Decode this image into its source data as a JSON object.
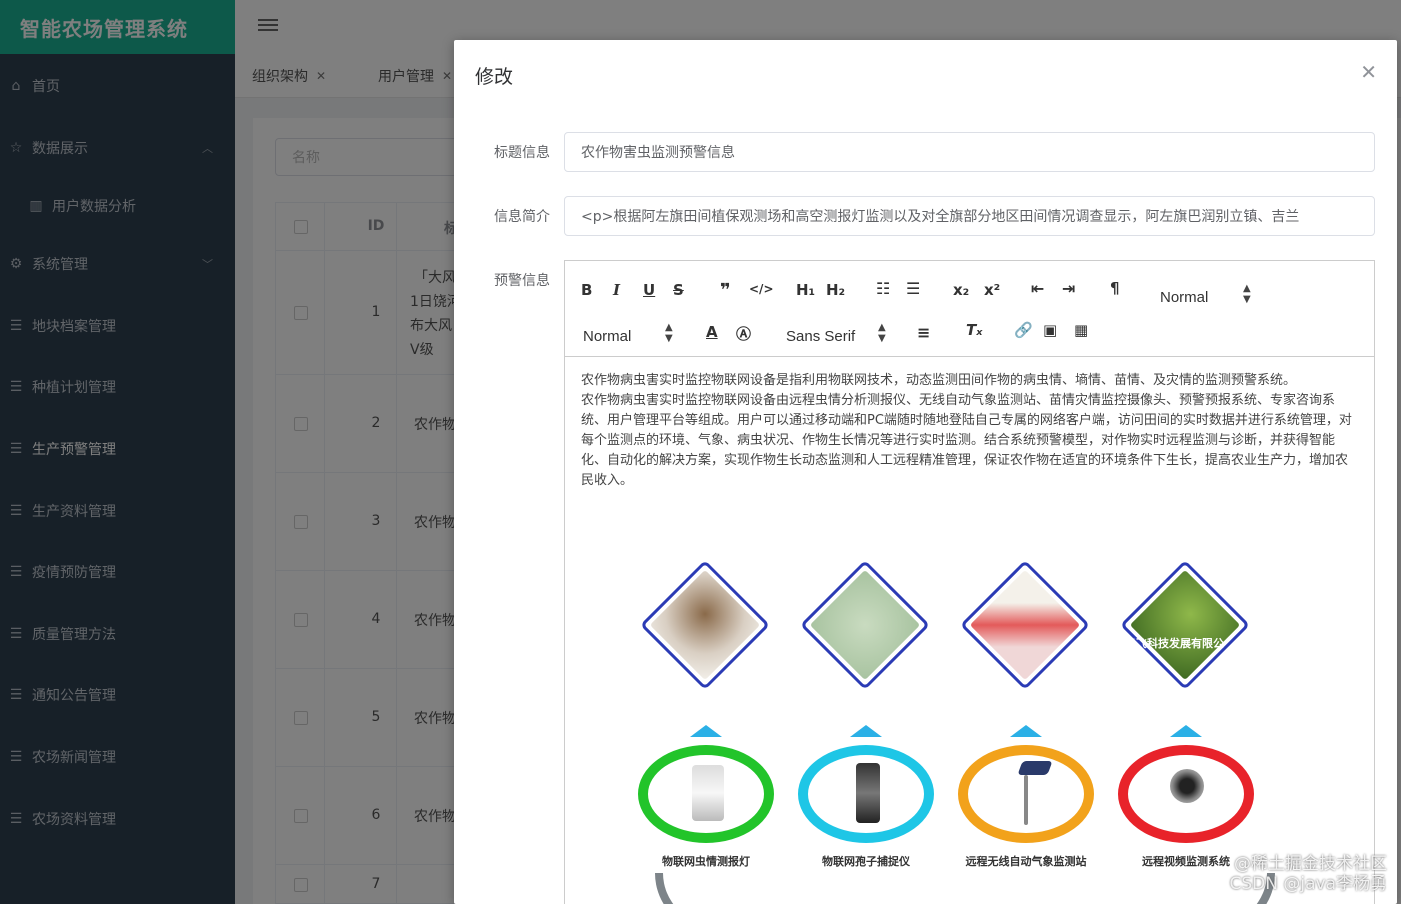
{
  "app": {
    "title": "智能农场管理系统"
  },
  "sidebar": {
    "items": [
      {
        "label": "首页",
        "icon": "home-icon"
      },
      {
        "label": "数据展示",
        "icon": "star-icon",
        "expanded": true
      },
      {
        "label": "用户数据分析",
        "icon": "chart-icon",
        "sub": true
      },
      {
        "label": "系统管理",
        "icon": "gear-icon"
      },
      {
        "label": "地块档案管理",
        "icon": "list-icon"
      },
      {
        "label": "种植计划管理",
        "icon": "list-icon"
      },
      {
        "label": "生产预警管理",
        "icon": "list-icon",
        "active": true
      },
      {
        "label": "生产资料管理",
        "icon": "list-icon"
      },
      {
        "label": "疫情预防管理",
        "icon": "list-icon"
      },
      {
        "label": "质量管理方法",
        "icon": "list-icon"
      },
      {
        "label": "通知公告管理",
        "icon": "list-icon"
      },
      {
        "label": "农场新闻管理",
        "icon": "list-icon"
      },
      {
        "label": "农场资料管理",
        "icon": "list-icon"
      }
    ]
  },
  "tabs": [
    {
      "label": "组织架构"
    },
    {
      "label": "用户管理"
    }
  ],
  "background": {
    "search_placeholder": "名称",
    "table": {
      "id_header": "ID",
      "title_header_fragment": "标",
      "rows": [
        {
          "id": "1",
          "lines": [
            "「大风",
            "1日饶河",
            "布大风",
            "V级"
          ]
        },
        {
          "id": "2",
          "lines": [
            "农作物"
          ]
        },
        {
          "id": "3",
          "lines": [
            "农作物"
          ]
        },
        {
          "id": "4",
          "lines": [
            "农作物"
          ]
        },
        {
          "id": "5",
          "lines": [
            "农作物"
          ]
        },
        {
          "id": "6",
          "lines": [
            "农作物"
          ]
        },
        {
          "id": "7",
          "lines": []
        }
      ]
    }
  },
  "dialog": {
    "title": "修改",
    "fields": {
      "title_label": "标题信息",
      "title_value": "农作物害虫监测预警信息",
      "intro_label": "信息简介",
      "intro_value": "<p>根据阿左旗田间植保观测场和高空测报灯监测以及对全旗部分地区田间情况调查显示，阿左旗巴润别立镇、吉兰",
      "warning_label": "预警信息"
    },
    "toolbar": {
      "header_select": "Normal",
      "size_select": "Normal",
      "font_select": "Sans Serif"
    },
    "content": {
      "p1": "农作物病虫害实时监控物联网设备是指利用物联网技术，动态监测田间作物的病虫情、墒情、苗情、及灾情的监测预警系统。",
      "p2": "农作物病虫害实时监控物联网设备由远程虫情分析测报仪、无线自动气象监测站、苗情灾情监控摄像头、预警预报系统、专家咨询系统、用户管理平台等组成。用户可以通过移动端和PC端随时随地登陆自己专属的网络客户端，访问田间的实时数据并进行系统管理，对每个监测点的环境、气象、病虫状况、作物生长情况等进行实时监测。结合系统预警模型，对作物实时远程监测与诊断，并获得智能化、自动化的解决方案，实现作物生长动态监测和人工远程精准管理，保证农作物在适宜的环境条件下生长，提高农业生产力，增加农民收入。"
    },
    "illustration": {
      "banner_text": "云飞科技发展有限公",
      "captions": [
        "物联网虫情测报灯",
        "物联网孢子捕捉仪",
        "远程无线自动气象监测站",
        "远程视频监测系统"
      ]
    }
  },
  "watermark": {
    "line1": "@稀土掘金技术社区",
    "line2": "CSDN @java李杨勇"
  }
}
